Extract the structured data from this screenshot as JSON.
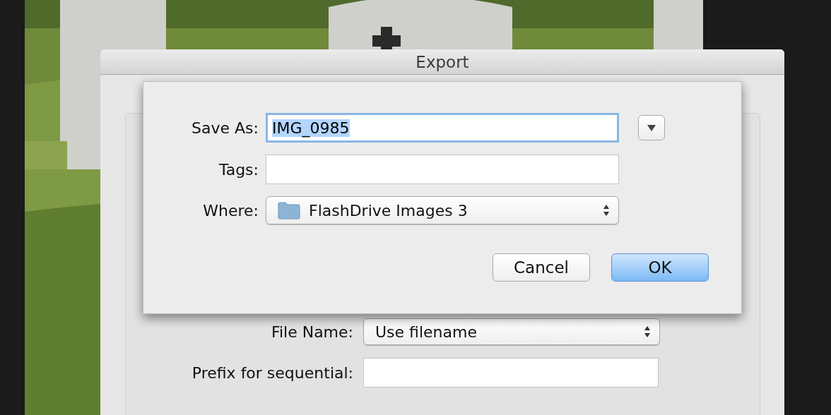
{
  "window": {
    "title": "Export"
  },
  "save_sheet": {
    "save_as": {
      "label": "Save As:",
      "value": "IMG_0985",
      "selected": true
    },
    "tags": {
      "label": "Tags:"
    },
    "where": {
      "label": "Where:",
      "value": "FlashDrive Images 3"
    },
    "buttons": [
      {
        "label": "Cancel",
        "default": false
      },
      {
        "label": "OK",
        "default": true
      }
    ]
  },
  "export_options": {
    "file_name": {
      "label": "File Name:",
      "value": "Use filename"
    },
    "prefix": {
      "label": "Prefix for sequential:"
    }
  }
}
